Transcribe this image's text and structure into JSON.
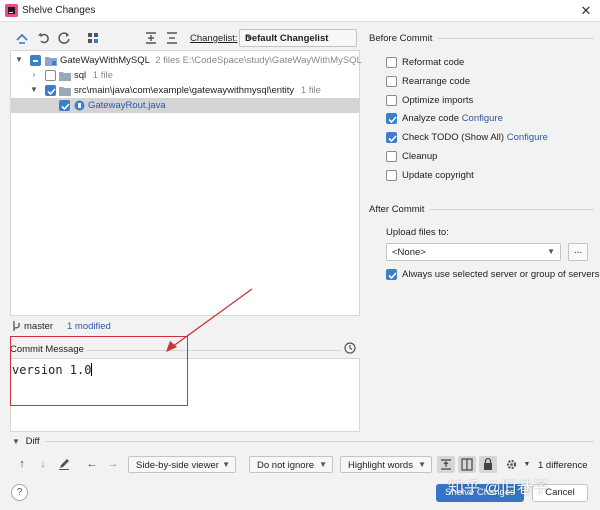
{
  "window": {
    "title": "Shelve Changes",
    "close_glyph": "✕"
  },
  "toolbar": {
    "icons": [
      "diff-arrows-icon",
      "undo-icon",
      "refresh-icon",
      "group-by-icon",
      "expand-all-icon",
      "collapse-all-icon"
    ],
    "changelist_label": "Changelist:",
    "changelist_value": "Default Changelist"
  },
  "tree": {
    "root": {
      "name": "GateWayWithMySQL",
      "meta": "2 files  E:\\CodeSpace\\study\\GateWayWithMySQL"
    },
    "sql": {
      "name": "sql",
      "meta": "1 file"
    },
    "entity": {
      "name": "src\\main\\java\\com\\example\\gatewaywithmysql\\entity",
      "meta": "1 file"
    },
    "file": {
      "name": "GatewayRout.java"
    }
  },
  "status": {
    "branch": "master",
    "modified": "1 modified"
  },
  "commit": {
    "label": "Commit Message",
    "message": "version 1.0"
  },
  "before_commit": {
    "title": "Before Commit",
    "options": [
      {
        "label": "Reformat code",
        "checked": false
      },
      {
        "label": "Rearrange code",
        "checked": false
      },
      {
        "label": "Optimize imports",
        "checked": false
      },
      {
        "label": "Analyze code",
        "link": "Configure",
        "checked": true
      },
      {
        "label": "Check TODO (Show All)",
        "link": "Configure",
        "checked": true
      },
      {
        "label": "Cleanup",
        "checked": false
      },
      {
        "label": "Update copyright",
        "checked": false
      }
    ]
  },
  "after_commit": {
    "title": "After Commit",
    "upload_label": "Upload files to:",
    "upload_value": "<None>",
    "ellipsis": "...",
    "always_use_label": "Always use selected server or group of servers"
  },
  "diff": {
    "title": "Diff",
    "viewer": "Side-by-side viewer",
    "ignore": "Do not ignore",
    "highlight": "Highlight words",
    "count": "1 difference"
  },
  "buttons": {
    "help": "?",
    "shelve": "Shelve Changes",
    "cancel": "Cancel"
  },
  "watermark": "知乎 @旧巷子",
  "colors": {
    "accent": "#3574c6",
    "link": "#2a57a8",
    "annotation": "#d0303a"
  }
}
